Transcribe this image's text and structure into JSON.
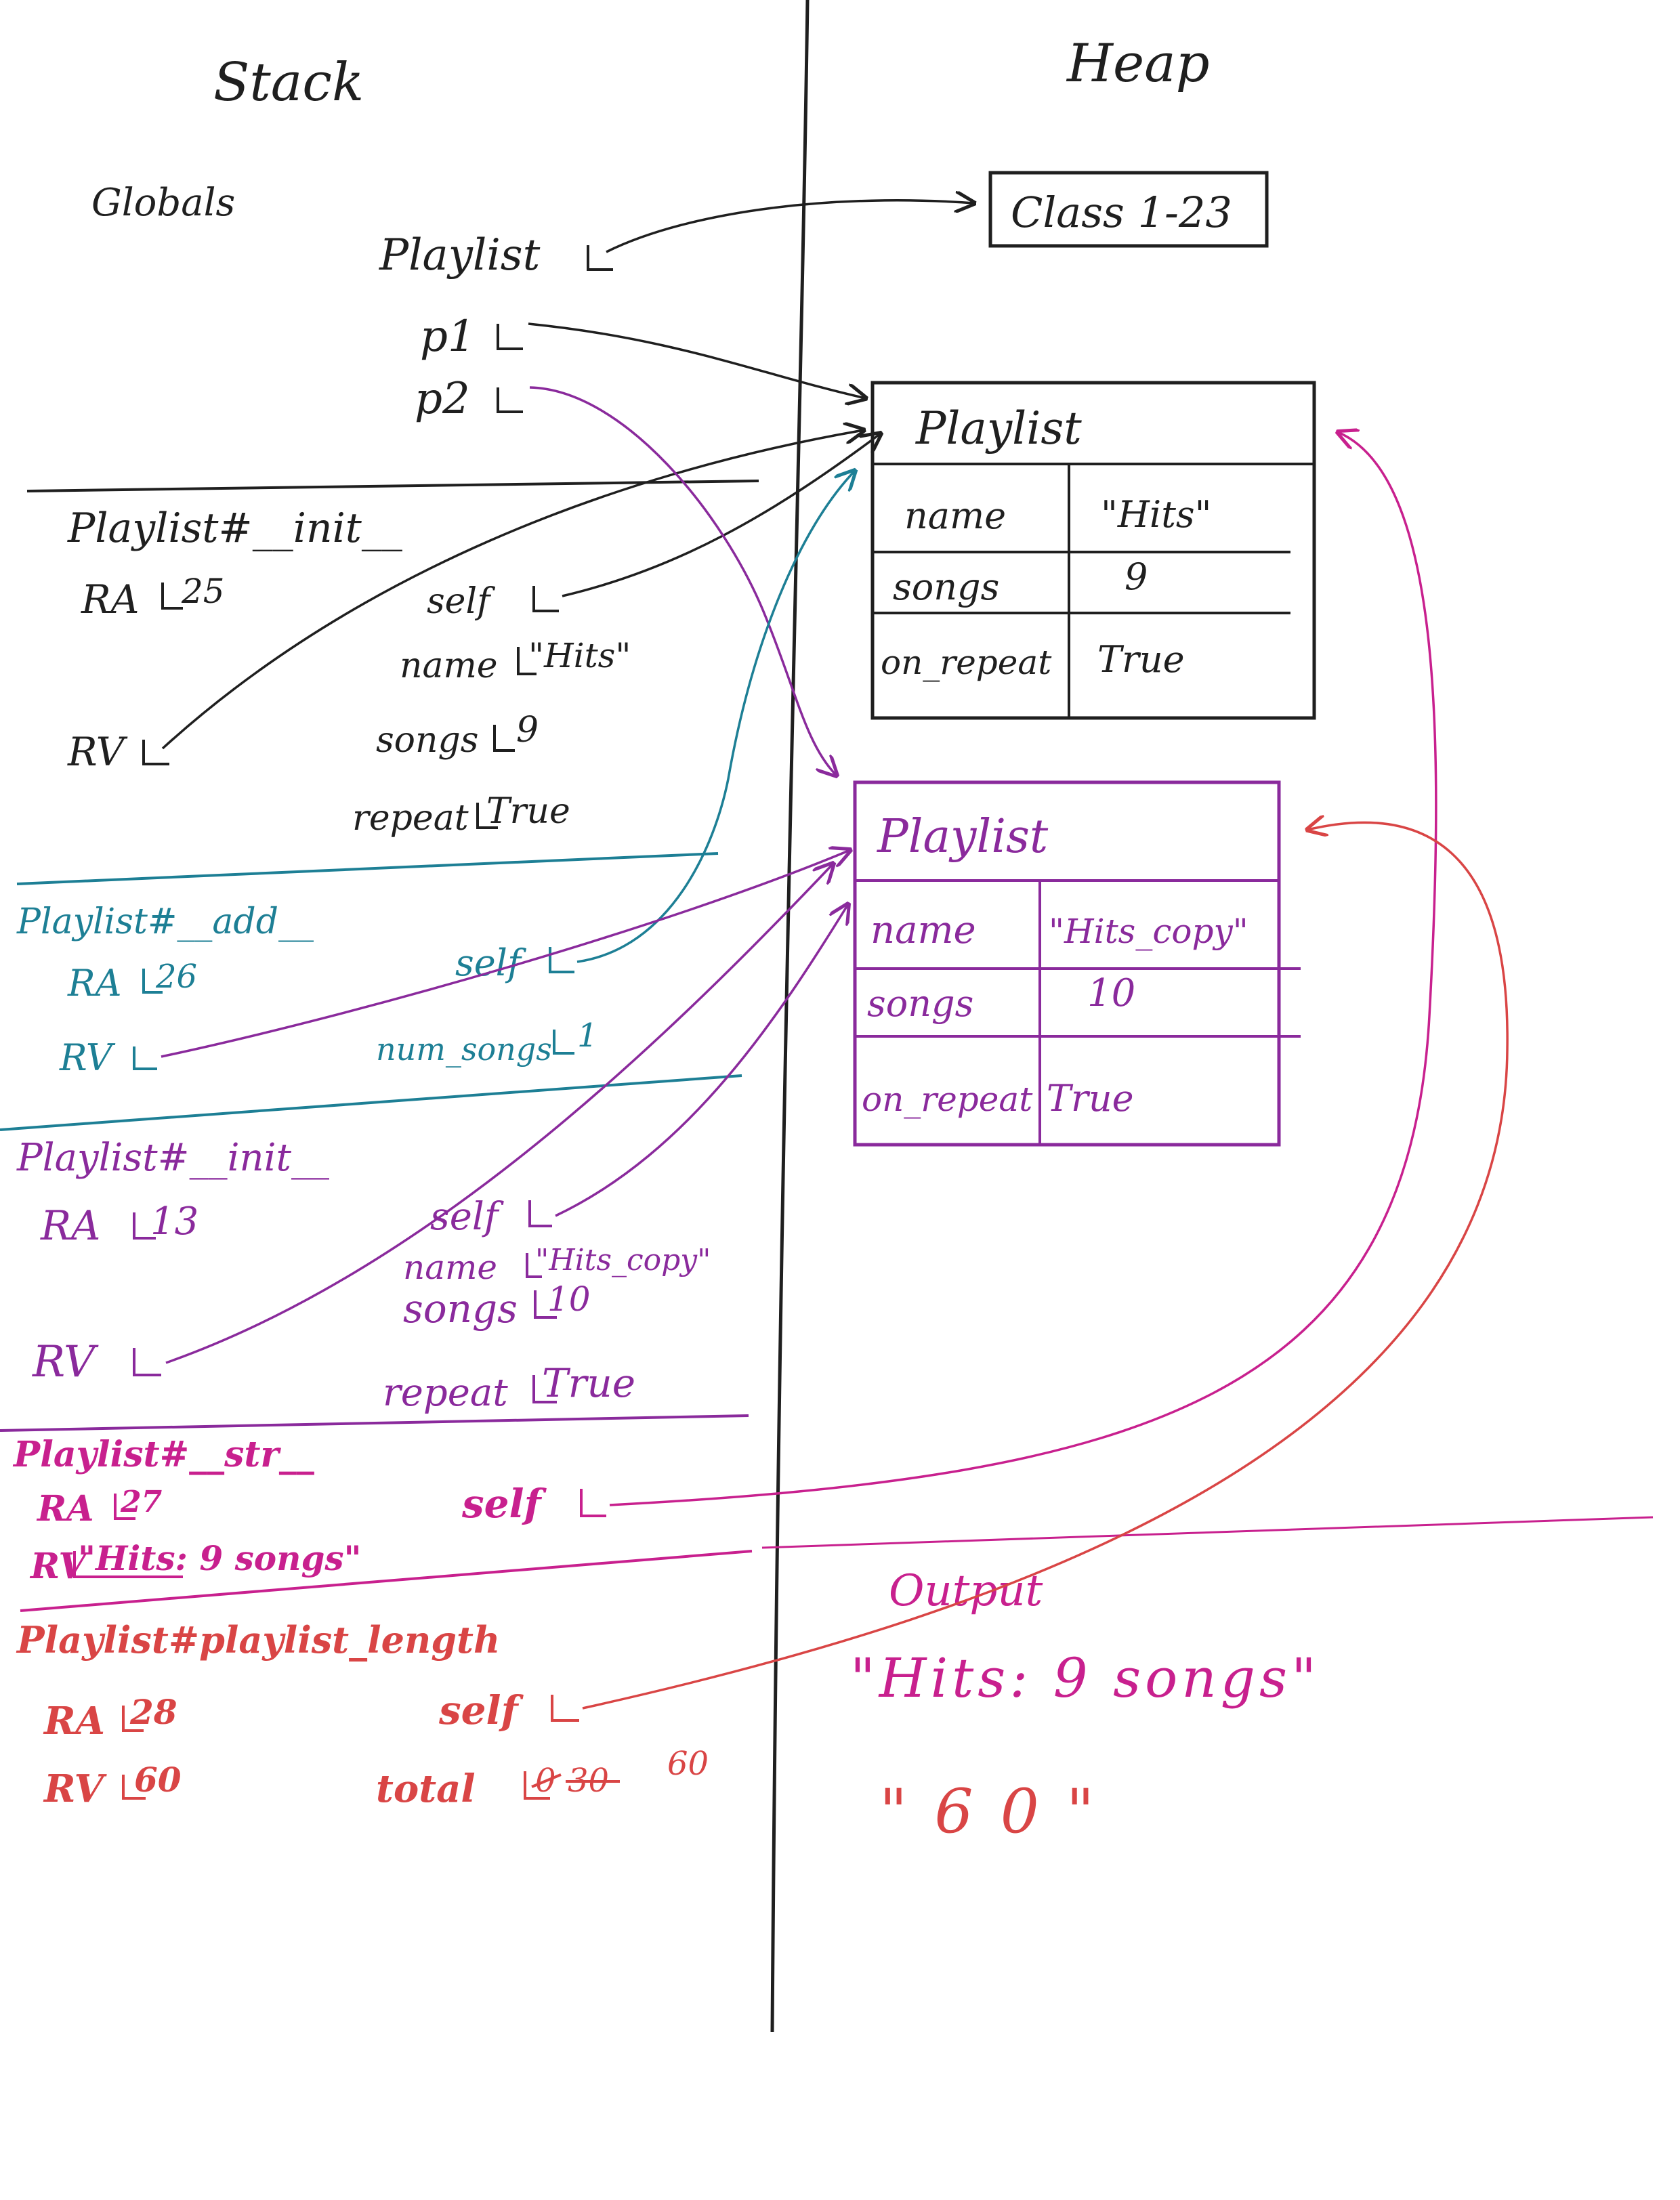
{
  "headers": {
    "stack": "Stack",
    "heap": "Heap"
  },
  "colors": {
    "black": "#1f1f1f",
    "teal": "#1d7f95",
    "purple": "#8a2a9c",
    "magenta": "#c8208e",
    "red": "#d94545"
  },
  "globals": {
    "title": "Globals",
    "vars": [
      {
        "name": "Playlist"
      },
      {
        "name": "p1"
      },
      {
        "name": "p2"
      }
    ]
  },
  "heap": {
    "class_box": "Class 1-23",
    "object1": {
      "title": "Playlist",
      "rows": [
        {
          "key": "name",
          "value": "\"Hits\""
        },
        {
          "key": "songs",
          "value": "9"
        },
        {
          "key": "on_repeat",
          "value": "True"
        }
      ]
    },
    "object2": {
      "title": "Playlist",
      "rows": [
        {
          "key": "name",
          "value": "\"Hits_copy\""
        },
        {
          "key": "songs",
          "value": "10"
        },
        {
          "key": "on_repeat",
          "value": "True"
        }
      ]
    }
  },
  "frames": [
    {
      "title": "Playlist#__init__",
      "ra": "RA",
      "ra_val": "25",
      "rv": "RV",
      "locals": [
        {
          "name": "self",
          "value": ""
        },
        {
          "name": "name",
          "value": "\"Hits\""
        },
        {
          "name": "songs",
          "value": "9"
        },
        {
          "name": "repeat",
          "value": "True"
        }
      ]
    },
    {
      "title": "Playlist#__add__",
      "ra": "RA",
      "ra_val": "26",
      "rv": "RV",
      "locals": [
        {
          "name": "self",
          "value": ""
        },
        {
          "name": "num_songs",
          "value": "1"
        }
      ]
    },
    {
      "title": "Playlist#__init__",
      "ra": "RA",
      "ra_val": "13",
      "rv": "RV",
      "locals": [
        {
          "name": "self",
          "value": ""
        },
        {
          "name": "name",
          "value": "\"Hits_copy\""
        },
        {
          "name": "songs",
          "value": "10"
        },
        {
          "name": "repeat",
          "value": "True"
        }
      ]
    },
    {
      "title": "Playlist#__str__",
      "ra": "RA",
      "ra_val": "27",
      "rv": "RV",
      "rv_val": "\"Hits: 9 songs\"",
      "locals": [
        {
          "name": "self",
          "value": ""
        }
      ]
    },
    {
      "title": "Playlist#playlist_length",
      "ra": "RA",
      "ra_val": "28",
      "rv": "RV",
      "rv_val": "60",
      "locals": [
        {
          "name": "self",
          "value": ""
        },
        {
          "name": "total",
          "value": "0",
          "crossed": "30",
          "final": "60"
        }
      ]
    }
  ],
  "output": {
    "title": "Output",
    "lines": [
      "\"Hits: 9 songs\"",
      "\"60\""
    ]
  }
}
